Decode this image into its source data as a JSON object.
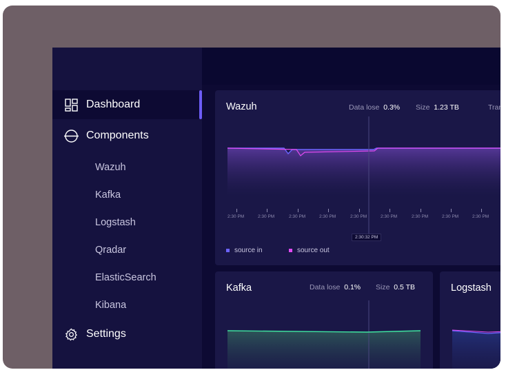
{
  "sidebar": {
    "items": [
      {
        "label": "Dashboard",
        "icon": "dashboard-grid-icon"
      },
      {
        "label": "Components",
        "icon": "components-circle-icon"
      },
      {
        "label": "Settings",
        "icon": "gear-icon"
      }
    ],
    "components": [
      "Wazuh",
      "Kafka",
      "Logstash",
      "Qradar",
      "ElasticSearch",
      "Kibana"
    ]
  },
  "cards": {
    "wazuh": {
      "title": "Wazuh",
      "data_lose_label": "Data lose",
      "data_lose": "0.3%",
      "size_label": "Size",
      "size": "1.23 TB",
      "extra": "Tran",
      "ticks": [
        "2:30 PM",
        "2:30 PM",
        "2:30 PM",
        "2:30 PM",
        "2:30 PM",
        "2:30 PM",
        "2:30 PM",
        "2:30 PM",
        "2:30 PM"
      ],
      "tooltip": "2:30:32 PM",
      "legend": [
        {
          "label": "source in",
          "color": "#6c63ff"
        },
        {
          "label": "source out",
          "color": "#e24bf2"
        }
      ]
    },
    "kafka": {
      "title": "Kafka",
      "data_lose_label": "Data lose",
      "data_lose": "0.1%",
      "size_label": "Size",
      "size": "0.5 TB"
    },
    "logstash": {
      "title": "Logstash"
    }
  },
  "colors": {
    "accent": "#6d5cf6",
    "source_in": "#6c63ff",
    "source_out": "#e24bf2",
    "kafka_line": "#3fe3a0"
  }
}
